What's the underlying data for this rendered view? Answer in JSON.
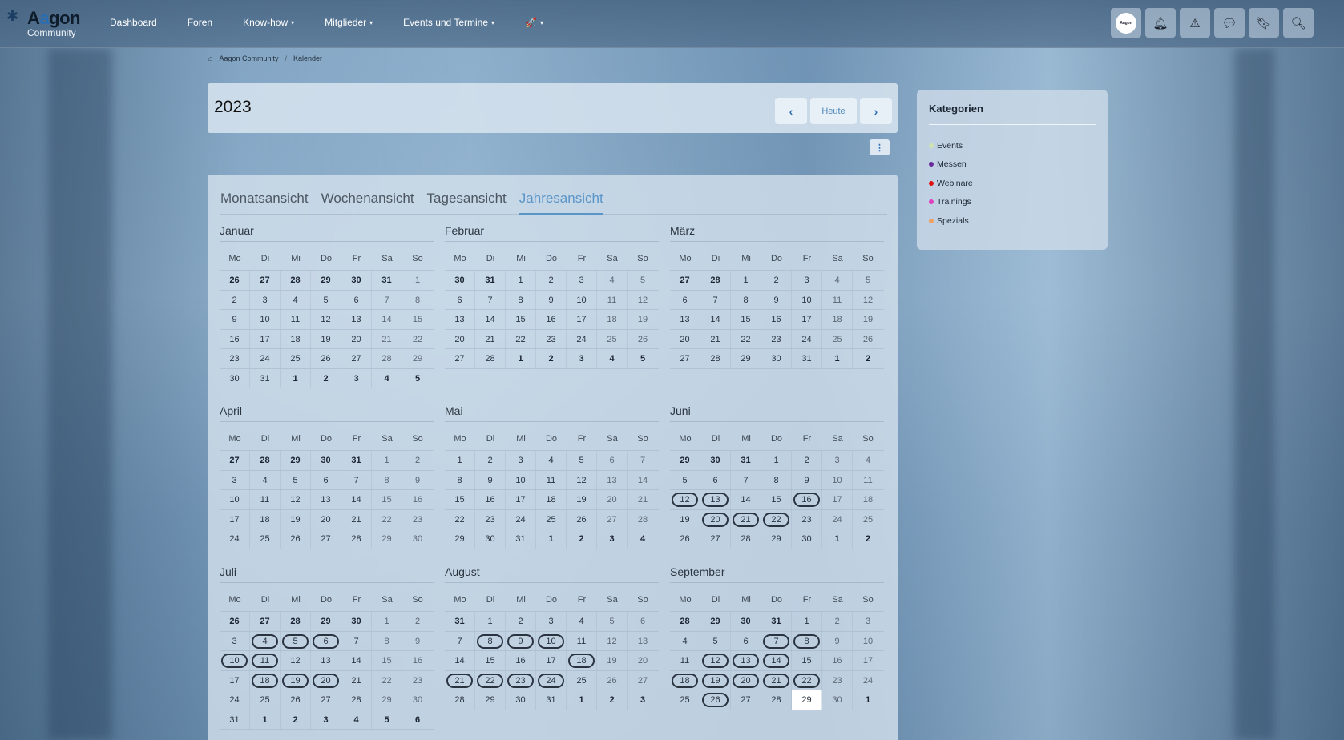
{
  "topbar": {
    "logo_name_a": "A",
    "logo_name_accent": "a",
    "logo_name_rest": "gon",
    "logo_sub": "Community",
    "nav": [
      {
        "label": "Dashboard",
        "dropdown": false
      },
      {
        "label": "Foren",
        "dropdown": false
      },
      {
        "label": "Know-how",
        "dropdown": true
      },
      {
        "label": "Mitglieder",
        "dropdown": true
      },
      {
        "label": "Events und Termine",
        "dropdown": true
      }
    ],
    "rocket_icon": "rocket-icon",
    "avatar_text": "Aagon",
    "icons": [
      "avatar",
      "bell-icon",
      "warning-icon",
      "chat-icon",
      "bookmark-icon",
      "search-icon"
    ]
  },
  "breadcrumb": {
    "home": "Aagon Community",
    "current": "Kalender"
  },
  "header": {
    "year": "2023",
    "today_label": "Heute"
  },
  "tabs": [
    {
      "label": "Monatsansicht",
      "active": false
    },
    {
      "label": "Wochenansicht",
      "active": false
    },
    {
      "label": "Tagesansicht",
      "active": false
    },
    {
      "label": "Jahresansicht",
      "active": true
    }
  ],
  "dow": [
    "Mo",
    "Di",
    "Mi",
    "Do",
    "Fr",
    "Sa",
    "So"
  ],
  "months": [
    {
      "name": "Januar",
      "weeks": [
        [
          26,
          27,
          28,
          29,
          30,
          31,
          1
        ],
        [
          2,
          3,
          4,
          5,
          6,
          7,
          8
        ],
        [
          9,
          10,
          11,
          12,
          13,
          14,
          15
        ],
        [
          16,
          17,
          18,
          19,
          20,
          21,
          22
        ],
        [
          23,
          24,
          25,
          26,
          27,
          28,
          29
        ],
        [
          30,
          31,
          1,
          2,
          3,
          4,
          5
        ]
      ],
      "lead": 6,
      "trail": 5,
      "events": []
    },
    {
      "name": "Februar",
      "weeks": [
        [
          30,
          31,
          1,
          2,
          3,
          4,
          5
        ],
        [
          6,
          7,
          8,
          9,
          10,
          11,
          12
        ],
        [
          13,
          14,
          15,
          16,
          17,
          18,
          19
        ],
        [
          20,
          21,
          22,
          23,
          24,
          25,
          26
        ],
        [
          27,
          28,
          1,
          2,
          3,
          4,
          5
        ]
      ],
      "lead": 2,
      "trail": 5,
      "events": []
    },
    {
      "name": "März",
      "weeks": [
        [
          27,
          28,
          1,
          2,
          3,
          4,
          5
        ],
        [
          6,
          7,
          8,
          9,
          10,
          11,
          12
        ],
        [
          13,
          14,
          15,
          16,
          17,
          18,
          19
        ],
        [
          20,
          21,
          22,
          23,
          24,
          25,
          26
        ],
        [
          27,
          28,
          29,
          30,
          31,
          1,
          2
        ]
      ],
      "lead": 2,
      "trail": 2,
      "events": []
    },
    {
      "name": "April",
      "weeks": [
        [
          27,
          28,
          29,
          30,
          31,
          1,
          2
        ],
        [
          3,
          4,
          5,
          6,
          7,
          8,
          9
        ],
        [
          10,
          11,
          12,
          13,
          14,
          15,
          16
        ],
        [
          17,
          18,
          19,
          20,
          21,
          22,
          23
        ],
        [
          24,
          25,
          26,
          27,
          28,
          29,
          30
        ]
      ],
      "lead": 5,
      "trail": 0,
      "events": []
    },
    {
      "name": "Mai",
      "weeks": [
        [
          1,
          2,
          3,
          4,
          5,
          6,
          7
        ],
        [
          8,
          9,
          10,
          11,
          12,
          13,
          14
        ],
        [
          15,
          16,
          17,
          18,
          19,
          20,
          21
        ],
        [
          22,
          23,
          24,
          25,
          26,
          27,
          28
        ],
        [
          29,
          30,
          31,
          1,
          2,
          3,
          4
        ]
      ],
      "lead": 0,
      "trail": 4,
      "events": []
    },
    {
      "name": "Juni",
      "weeks": [
        [
          29,
          30,
          31,
          1,
          2,
          3,
          4
        ],
        [
          5,
          6,
          7,
          8,
          9,
          10,
          11
        ],
        [
          12,
          13,
          14,
          15,
          16,
          17,
          18
        ],
        [
          19,
          20,
          21,
          22,
          23,
          24,
          25
        ],
        [
          26,
          27,
          28,
          29,
          30,
          1,
          2
        ]
      ],
      "lead": 3,
      "trail": 2,
      "events": [
        12,
        13,
        16,
        20,
        21,
        22
      ]
    },
    {
      "name": "Juli",
      "weeks": [
        [
          26,
          27,
          28,
          29,
          30,
          1,
          2
        ],
        [
          3,
          4,
          5,
          6,
          7,
          8,
          9
        ],
        [
          10,
          11,
          12,
          13,
          14,
          15,
          16
        ],
        [
          17,
          18,
          19,
          20,
          21,
          22,
          23
        ],
        [
          24,
          25,
          26,
          27,
          28,
          29,
          30
        ],
        [
          31,
          1,
          2,
          3,
          4,
          5,
          6
        ]
      ],
      "lead": 5,
      "trail": 6,
      "events": [
        4,
        5,
        6,
        10,
        11,
        18,
        19,
        20
      ]
    },
    {
      "name": "August",
      "weeks": [
        [
          31,
          1,
          2,
          3,
          4,
          5,
          6
        ],
        [
          7,
          8,
          9,
          10,
          11,
          12,
          13
        ],
        [
          14,
          15,
          16,
          17,
          18,
          19,
          20
        ],
        [
          21,
          22,
          23,
          24,
          25,
          26,
          27
        ],
        [
          28,
          29,
          30,
          31,
          1,
          2,
          3
        ]
      ],
      "lead": 1,
      "trail": 3,
      "events": [
        8,
        9,
        10,
        18,
        21,
        22,
        23,
        24
      ]
    },
    {
      "name": "September",
      "weeks": [
        [
          28,
          29,
          30,
          31,
          1,
          2,
          3
        ],
        [
          4,
          5,
          6,
          7,
          8,
          9,
          10
        ],
        [
          11,
          12,
          13,
          14,
          15,
          16,
          17
        ],
        [
          18,
          19,
          20,
          21,
          22,
          23,
          24
        ],
        [
          25,
          26,
          27,
          28,
          29,
          30,
          1
        ]
      ],
      "lead": 4,
      "trail": 1,
      "events": [
        7,
        8,
        12,
        13,
        14,
        18,
        19,
        20,
        21,
        22,
        26
      ],
      "today": 29
    }
  ],
  "sidebar": {
    "title": "Kategorien",
    "categories": [
      {
        "label": "Events",
        "color": "#cfe3b0"
      },
      {
        "label": "Messen",
        "color": "#6a2a9a"
      },
      {
        "label": "Webinare",
        "color": "#e01010"
      },
      {
        "label": "Trainings",
        "color": "#e040c0"
      },
      {
        "label": "Spezials",
        "color": "#f0a060"
      }
    ]
  }
}
